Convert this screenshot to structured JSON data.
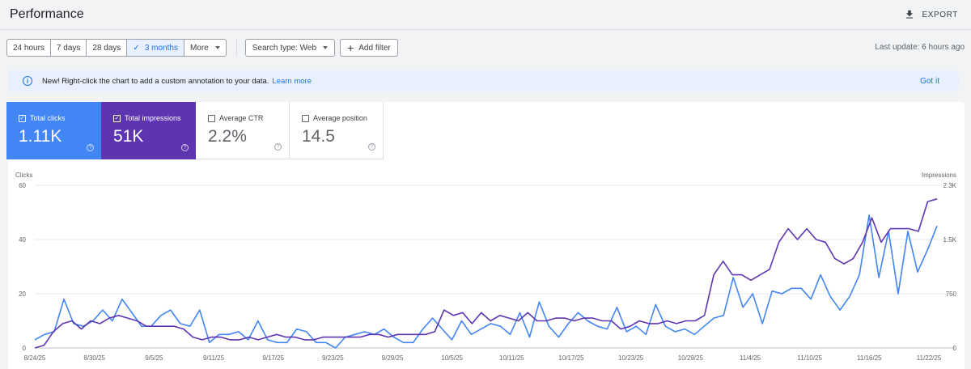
{
  "header": {
    "title": "Performance",
    "export_label": "EXPORT"
  },
  "filters": {
    "ranges": [
      {
        "label": "24 hours",
        "active": false
      },
      {
        "label": "7 days",
        "active": false
      },
      {
        "label": "28 days",
        "active": false
      },
      {
        "label": "3 months",
        "active": true
      },
      {
        "label": "More",
        "active": false
      }
    ],
    "search_type": "Search type: Web",
    "add_filter": "Add filter",
    "last_update": "Last update: 6 hours ago"
  },
  "banner": {
    "text": "New! Right-click the chart to add a custom annotation to your data.",
    "link": "Learn more",
    "dismiss": "Got it"
  },
  "metrics": [
    {
      "label": "Total clicks",
      "value": "1.11K",
      "checked": true
    },
    {
      "label": "Total impressions",
      "value": "51K",
      "checked": true
    },
    {
      "label": "Average CTR",
      "value": "2.2%",
      "checked": false
    },
    {
      "label": "Average position",
      "value": "14.5",
      "checked": false
    }
  ],
  "colors": {
    "clicks": "#4285f4",
    "impressions": "#5e35b1",
    "accent": "#1a73e8"
  },
  "chart_data": {
    "type": "line",
    "left_axis": {
      "label": "Clicks",
      "ticks": [
        "0",
        "20",
        "40",
        "60"
      ],
      "range": [
        0,
        60
      ]
    },
    "right_axis": {
      "label": "Impressions",
      "ticks": [
        "0",
        "750",
        "1.5K",
        "2.3K"
      ],
      "range": [
        0,
        2300
      ]
    },
    "x_tick_labels": [
      "8/24/25",
      "8/30/25",
      "9/5/25",
      "9/11/25",
      "9/17/25",
      "9/23/25",
      "9/29/25",
      "10/5/25",
      "10/11/25",
      "10/17/25",
      "10/23/25",
      "10/29/25",
      "11/4/25",
      "11/10/25",
      "11/16/25",
      "11/22/25"
    ],
    "grid": true,
    "series": [
      {
        "name": "Clicks",
        "axis": "left",
        "color": "#4285f4",
        "values": [
          3,
          5,
          6,
          18,
          9,
          8,
          10,
          14,
          10,
          18,
          13,
          8,
          8,
          12,
          14,
          9,
          8,
          14,
          2,
          5,
          5,
          6,
          3,
          10,
          3,
          2,
          2,
          7,
          6,
          2,
          2,
          0,
          4,
          5,
          6,
          5,
          7,
          4,
          2,
          2,
          7,
          11,
          7,
          3,
          10,
          5,
          7,
          9,
          8,
          5,
          13,
          4,
          17,
          8,
          4,
          9,
          13,
          10,
          8,
          7,
          15,
          6,
          8,
          5,
          16,
          8,
          6,
          7,
          5,
          8,
          11,
          12,
          26,
          15,
          20,
          9,
          21,
          20,
          22,
          22,
          18,
          27,
          19,
          14,
          19,
          27,
          49,
          26,
          43,
          20,
          43,
          28,
          36,
          45
        ]
      },
      {
        "name": "Impressions",
        "axis": "left",
        "color": "#5e35b1",
        "values": [
          0,
          1,
          6,
          9,
          10,
          7,
          10,
          9,
          11,
          12,
          11,
          10,
          8,
          8,
          8,
          8,
          7,
          4,
          3,
          4,
          4,
          3,
          3,
          4,
          3,
          4,
          5,
          4,
          4,
          3,
          3,
          4,
          4,
          4,
          4,
          4,
          5,
          5,
          4,
          5,
          5,
          5,
          5,
          6,
          14,
          12,
          13,
          9,
          13,
          10,
          12,
          11,
          10,
          13,
          10,
          10,
          11,
          11,
          10,
          11,
          11,
          10,
          10,
          7,
          8,
          10,
          9,
          9,
          10,
          9,
          10,
          10,
          12,
          27,
          32,
          27,
          27,
          25,
          27,
          29,
          39,
          44,
          40,
          44,
          40,
          39,
          33,
          31,
          33,
          39,
          48,
          39,
          44,
          44,
          44,
          43,
          54,
          55
        ]
      }
    ]
  }
}
